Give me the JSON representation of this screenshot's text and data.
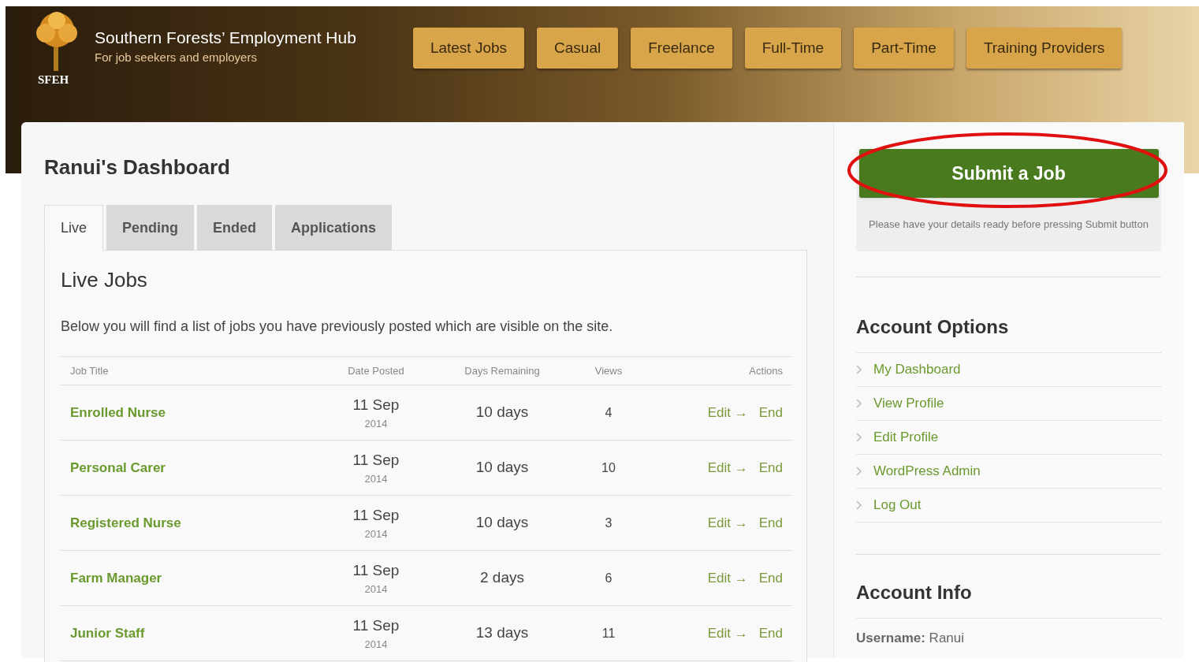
{
  "site": {
    "title": "Southern Forests’ Employment Hub",
    "tagline": "For job seekers and employers",
    "logo_text": "SFEH"
  },
  "nav": [
    {
      "label": "Latest Jobs"
    },
    {
      "label": "Casual"
    },
    {
      "label": "Freelance"
    },
    {
      "label": "Full-Time"
    },
    {
      "label": "Part-Time"
    },
    {
      "label": "Training Providers"
    }
  ],
  "dashboard_title": "Ranui's Dashboard",
  "tabs": [
    {
      "label": "Live",
      "selected": true
    },
    {
      "label": "Pending",
      "selected": false
    },
    {
      "label": "Ended",
      "selected": false
    },
    {
      "label": "Applications",
      "selected": false
    }
  ],
  "panel": {
    "heading": "Live Jobs",
    "description": "Below you will find a list of jobs you have previously posted which are visible on the site."
  },
  "table": {
    "columns": [
      "Job Title",
      "Date Posted",
      "Days Remaining",
      "Views",
      "Actions"
    ],
    "rows": [
      {
        "title": "Enrolled Nurse",
        "date": "11 Sep",
        "year": "2014",
        "remaining": "10 days",
        "views": "4",
        "edit": "Edit →",
        "end": "End"
      },
      {
        "title": "Personal Carer",
        "date": "11 Sep",
        "year": "2014",
        "remaining": "10 days",
        "views": "10",
        "edit": "Edit →",
        "end": "End"
      },
      {
        "title": "Registered Nurse",
        "date": "11 Sep",
        "year": "2014",
        "remaining": "10 days",
        "views": "3",
        "edit": "Edit →",
        "end": "End"
      },
      {
        "title": "Farm Manager",
        "date": "11 Sep",
        "year": "2014",
        "remaining": "2 days",
        "views": "6",
        "edit": "Edit →",
        "end": "End"
      },
      {
        "title": "Junior Staff",
        "date": "11 Sep",
        "year": "2014",
        "remaining": "13 days",
        "views": "11",
        "edit": "Edit →",
        "end": "End"
      }
    ]
  },
  "sidebar": {
    "submit_button": "Submit a Job",
    "submit_note": "Please have your details ready before pressing Submit button",
    "account_options": {
      "heading": "Account Options",
      "items": [
        "My Dashboard",
        "View Profile",
        "Edit Profile",
        "WordPress Admin",
        "Log Out"
      ]
    },
    "account_info": {
      "heading": "Account Info",
      "username": "**Username:** Ranui"
    }
  }
}
